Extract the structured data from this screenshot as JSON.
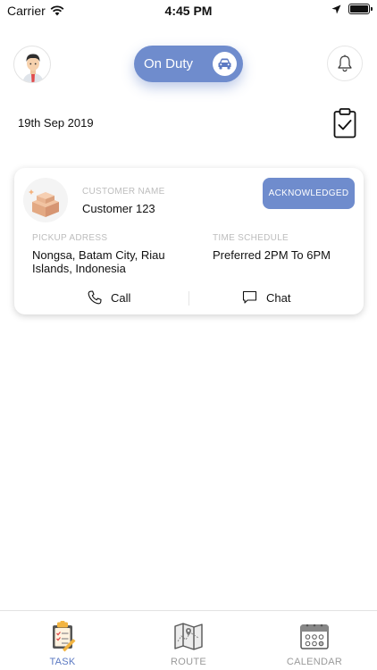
{
  "status_bar": {
    "carrier": "Carrier",
    "time": "4:45 PM"
  },
  "header": {
    "duty_label": "On Duty"
  },
  "date": "19th Sep 2019",
  "task": {
    "customer_name_label": "CUSTOMER NAME",
    "customer_name": "Customer 123",
    "status": "ACKNOWLEDGED",
    "pickup_label": "PICKUP ADRESS",
    "pickup_address": "Nongsa, Batam City, Riau Islands, Indonesia",
    "time_label": "TIME SCHEDULE",
    "time_schedule": "Preferred 2PM To 6PM",
    "call_label": "Call",
    "chat_label": "Chat"
  },
  "tabs": [
    {
      "label": "TASK",
      "icon": "task-clipboard-icon"
    },
    {
      "label": "ROUTE",
      "icon": "map-icon"
    },
    {
      "label": "CALENDAR",
      "icon": "calendar-icon"
    }
  ],
  "colors": {
    "accent": "#6f8ccd",
    "active_tab": "#5b79c2",
    "inactive_tab": "#9a9a9a"
  }
}
